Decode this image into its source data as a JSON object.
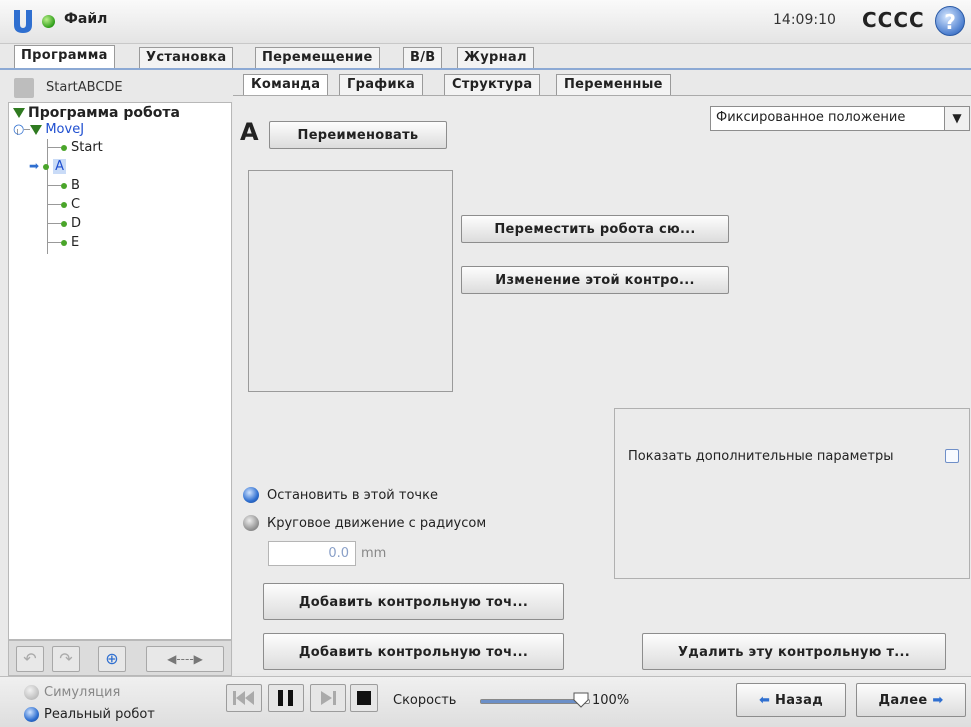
{
  "header": {
    "file_menu": "Файл",
    "time": "14:09:10",
    "robot_name": "CCCC",
    "help_symbol": "?"
  },
  "main_tabs": [
    {
      "label": "Программа",
      "active": true
    },
    {
      "label": "Установка",
      "active": false
    },
    {
      "label": "Перемещение",
      "active": false
    },
    {
      "label": "В/В",
      "active": false
    },
    {
      "label": "Журнал",
      "active": false
    }
  ],
  "left": {
    "program_name": "StartABCDE",
    "tree": {
      "root": "Программа робота",
      "movej": "MoveJ",
      "points": [
        "Start",
        "A",
        "B",
        "C",
        "D",
        "E"
      ],
      "selected": "A"
    }
  },
  "sub_tabs": [
    {
      "label": "Команда",
      "active": true
    },
    {
      "label": "Графика",
      "active": false
    },
    {
      "label": "Структура",
      "active": false
    },
    {
      "label": "Переменные",
      "active": false
    }
  ],
  "command": {
    "waypoint_name": "A",
    "rename_button": "Переименовать",
    "position_type": "Фиксированное положение",
    "move_here_button": "Переместить робота сю...",
    "change_waypoint_button": "Изменение этой контро...",
    "advanced_label": "Показать дополнительные параметры",
    "stop_here_label": "Остановить в этой точке",
    "blend_label": "Круговое движение с радиусом",
    "blend_value": "0.0",
    "blend_unit": "mm",
    "add_before_button": "Добавить контрольную точ...",
    "add_after_button": "Добавить контрольную точ...",
    "delete_button": "Удалить эту контрольную т..."
  },
  "footer": {
    "simulation_label": "Симуляция",
    "real_robot_label": "Реальный робот",
    "speed_label": "Скорость",
    "speed_value": "100%",
    "speed_fraction": 1.0,
    "back_button": "Назад",
    "next_button": "Далее"
  },
  "colors": {
    "accent": "#2f6fd0",
    "selected_bg": "#c9dbf7",
    "node_green": "#4aa52a",
    "link_blue": "#1f4fd0"
  }
}
